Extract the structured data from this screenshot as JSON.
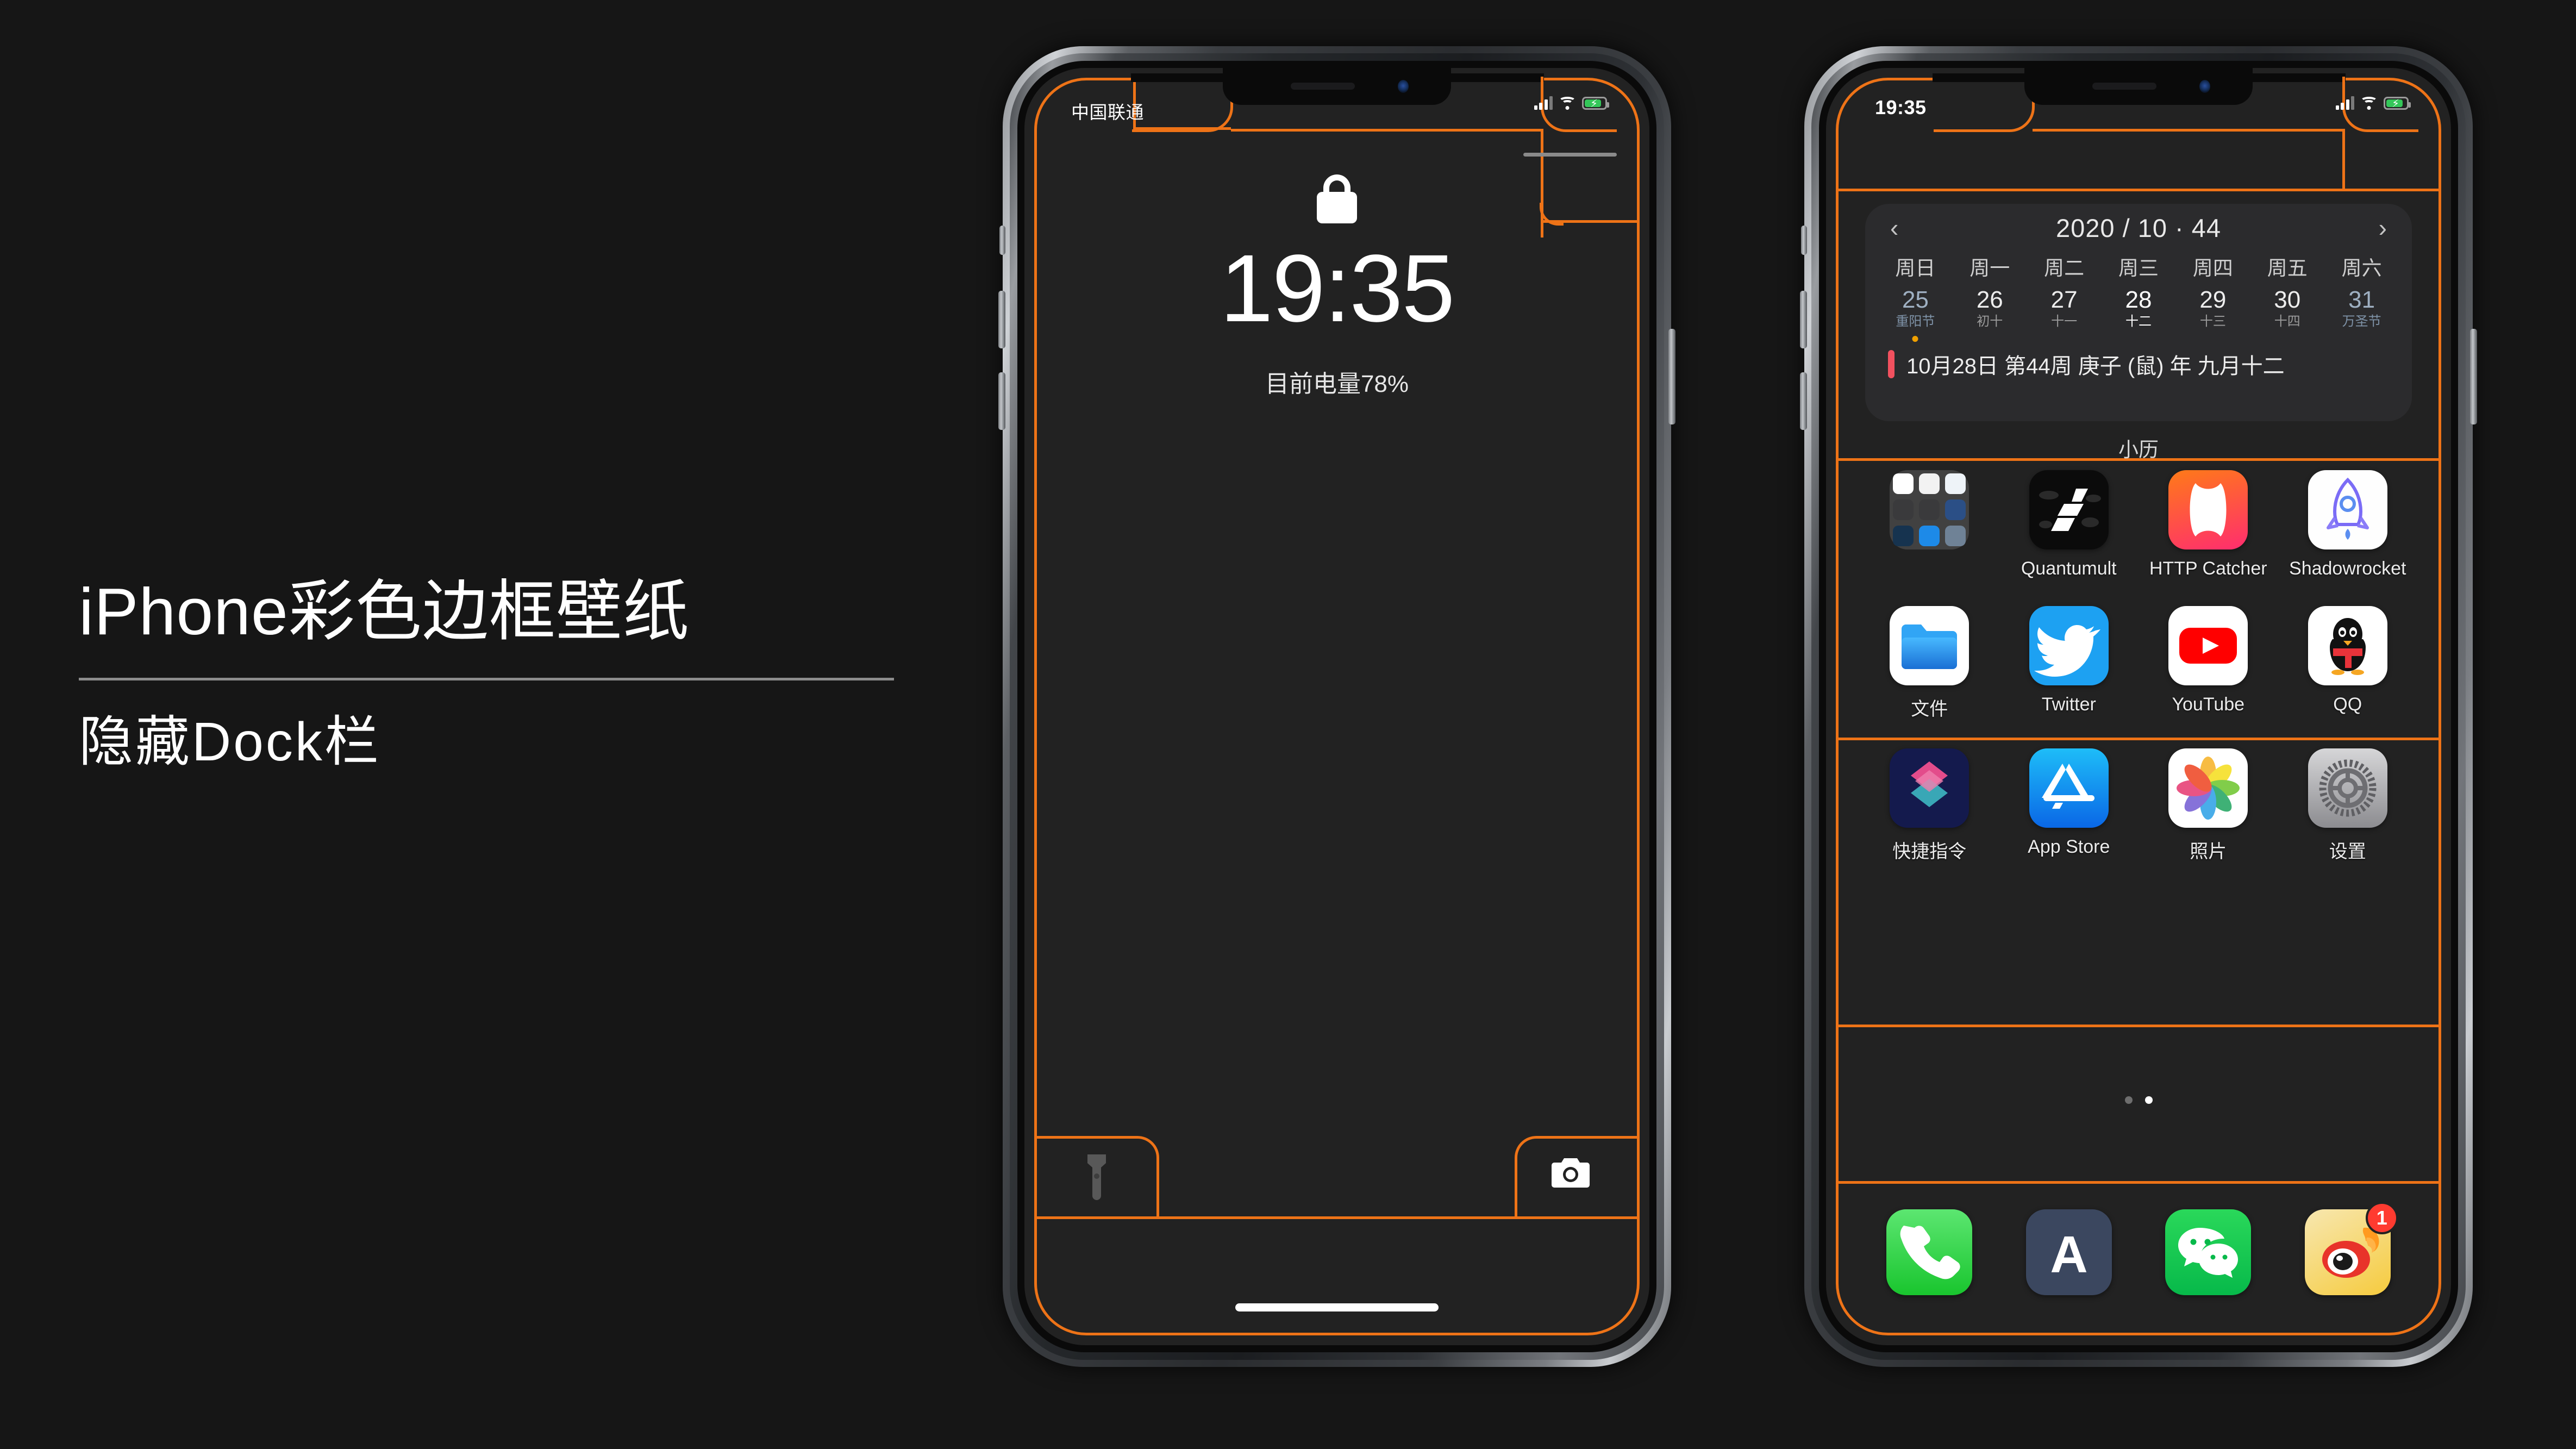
{
  "theme": {
    "canvas_bg": "#161616",
    "accent_orange": "#ee7317",
    "screen_bg": "#222222"
  },
  "headline": {
    "line1": "iPhone彩色边框壁纸",
    "line2": "隐藏Dock栏"
  },
  "lock_phone": {
    "status": {
      "carrier": "中国联通",
      "signal_icon": "cellular-bars-icon",
      "wifi_icon": "wifi-icon",
      "battery_icon": "battery-charging-icon"
    },
    "lock_icon": "lock-icon",
    "time": "19:35",
    "battery_text": "目前电量78%",
    "flashlight_icon": "flashlight-icon",
    "camera_icon": "camera-icon",
    "home_indicator": "home-indicator"
  },
  "home_phone": {
    "status": {
      "time": "19:35",
      "signal_icon": "cellular-bars-icon",
      "wifi_icon": "wifi-icon",
      "battery_icon": "battery-charging-icon"
    },
    "calendar_widget": {
      "prev_icon": "chevron-left-icon",
      "next_icon": "chevron-right-icon",
      "title": "2020 / 10 · 44",
      "weekdays": [
        "周日",
        "周一",
        "周二",
        "周三",
        "周四",
        "周五",
        "周六"
      ],
      "days": [
        {
          "num": "25",
          "lunar": "重阳节",
          "today": false,
          "holiday": true,
          "dot": true
        },
        {
          "num": "26",
          "lunar": "初十",
          "today": false,
          "holiday": false,
          "dot": false
        },
        {
          "num": "27",
          "lunar": "十一",
          "today": false,
          "holiday": false,
          "dot": false
        },
        {
          "num": "28",
          "lunar": "十二",
          "today": true,
          "holiday": false,
          "dot": false
        },
        {
          "num": "29",
          "lunar": "十三",
          "today": false,
          "holiday": false,
          "dot": false
        },
        {
          "num": "30",
          "lunar": "十四",
          "today": false,
          "holiday": false,
          "dot": false
        },
        {
          "num": "31",
          "lunar": "万圣节",
          "today": false,
          "holiday": true,
          "dot": false
        }
      ],
      "footer_text": "10月28日 第44周 庚子 (鼠) 年 九月十二",
      "widget_name": "小历",
      "today_color": "#f2616b"
    },
    "rows": [
      [
        {
          "label": "",
          "icon": "folder-icon",
          "kind": "folder"
        },
        {
          "label": "Quantumult",
          "icon": "quantumult-icon",
          "kind": "app"
        },
        {
          "label": "HTTP Catcher",
          "icon": "http-catcher-icon",
          "kind": "app"
        },
        {
          "label": "Shadowrocket",
          "icon": "shadowrocket-icon",
          "kind": "app"
        }
      ],
      [
        {
          "label": "文件",
          "icon": "files-icon",
          "kind": "app"
        },
        {
          "label": "Twitter",
          "icon": "twitter-icon",
          "kind": "app"
        },
        {
          "label": "YouTube",
          "icon": "youtube-icon",
          "kind": "app"
        },
        {
          "label": "QQ",
          "icon": "qq-icon",
          "kind": "app"
        }
      ],
      [
        {
          "label": "快捷指令",
          "icon": "shortcuts-icon",
          "kind": "app"
        },
        {
          "label": "App Store",
          "icon": "appstore-icon",
          "kind": "app"
        },
        {
          "label": "照片",
          "icon": "photos-icon",
          "kind": "app"
        },
        {
          "label": "设置",
          "icon": "settings-icon",
          "kind": "app"
        }
      ]
    ],
    "page_dots": {
      "count": 2,
      "active_index": 1
    },
    "dock": [
      {
        "icon": "phone-icon",
        "badge": ""
      },
      {
        "icon": "a-app-icon",
        "badge": ""
      },
      {
        "icon": "wechat-icon",
        "badge": ""
      },
      {
        "icon": "weibo-icon",
        "badge": "1"
      }
    ]
  }
}
